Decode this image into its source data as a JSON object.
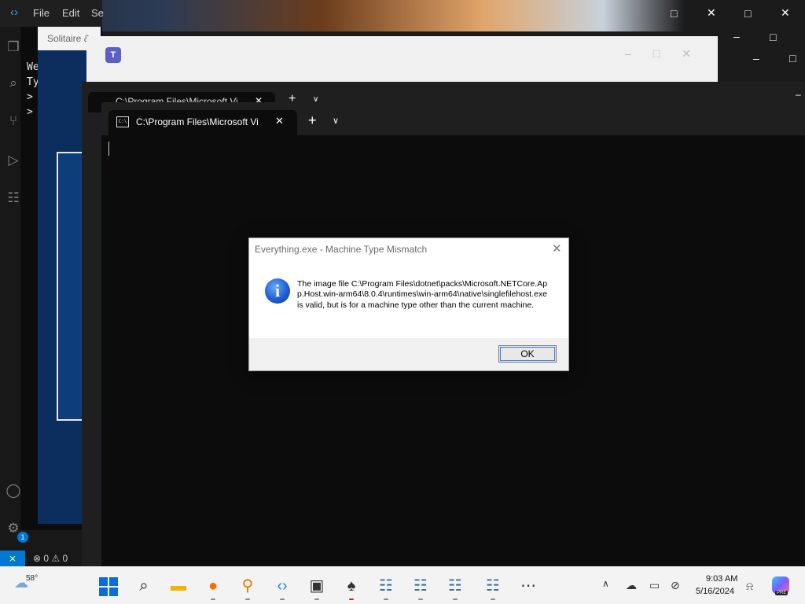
{
  "vscode": {
    "menu": [
      "File",
      "Edit",
      "Se"
    ],
    "terminal_lines": [
      "We",
      "Ty",
      ">",
      ">"
    ],
    "remote_icon": "remote-icon",
    "problems": "⊗ 0 ⚠ 0",
    "settings_badge": "1"
  },
  "solitaire": {
    "title": "Solitaire &"
  },
  "teams": {
    "icon": "teams-icon"
  },
  "terminal_back": {
    "tab_title": "C:\\Program Files\\Microsoft Vi"
  },
  "terminal_front": {
    "tab_title": "C:\\Program Files\\Microsoft Vi",
    "tab_icon_text": "C:\\",
    "new_tab": "+",
    "close": "✕",
    "dropdown": "∨"
  },
  "dialog": {
    "title": "Everything.exe - Machine Type Mismatch",
    "message": "The image file C:\\Program Files\\dotnet\\packs\\Microsoft.NETCore.App.Host.win-arm64\\8.0.4\\runtimes\\win-arm64\\native\\singlefilehost.exe is valid, but is for a machine type other than the current machine.",
    "ok_label": "OK",
    "icon": "info-icon",
    "icon_glyph": "i",
    "close": "✕"
  },
  "taskbar": {
    "weather_temp": "58°",
    "apps": [
      "windows-start",
      "search",
      "file-explorer",
      "firefox",
      "search-everything",
      "vscode",
      "terminal",
      "solitaire",
      "remote-desktop-1",
      "remote-desktop-2",
      "remote-desktop-3",
      "remote-desktop-4",
      "more"
    ],
    "time": "9:03 AM",
    "date": "5/16/2024",
    "copilot_badge": "PRE"
  },
  "colors": {
    "accent": "#0078d4",
    "dialog_bg": "#ffffff",
    "terminal_bg": "#0c0c0c",
    "taskbar_bg": "#f3f3f3"
  }
}
